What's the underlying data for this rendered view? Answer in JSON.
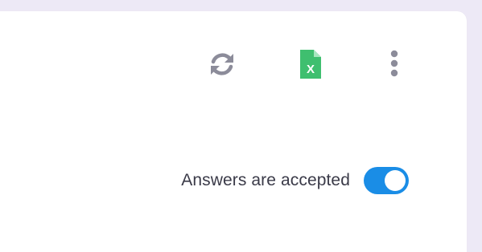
{
  "toolbar": {
    "refresh": {
      "icon": "refresh-icon",
      "color": "#8c8c9a"
    },
    "export_excel": {
      "icon": "excel-file-icon",
      "color": "#3fbf6f",
      "glyph": "X"
    },
    "more": {
      "icon": "more-vertical-icon",
      "color": "#8c8c9a"
    }
  },
  "responses": {
    "accepting_label": "Answers are accepted",
    "accepting_enabled": true,
    "toggle_color": "#1a8de6"
  }
}
